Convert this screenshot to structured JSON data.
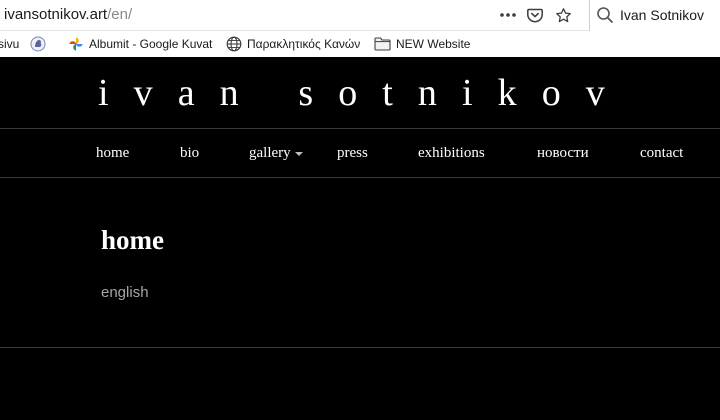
{
  "browser": {
    "url_host": "ivansotnikov.art",
    "url_path": "/en/",
    "search_value": "Ivan Sotnikov"
  },
  "bookmarks": [
    {
      "label": "sivu",
      "icon": "bookmark-icon"
    },
    {
      "label": "",
      "icon": "lion-logo-icon"
    },
    {
      "label": "Albumit - Google Kuvat",
      "icon": "google-photos-icon"
    },
    {
      "label": "Παρακλητικός Κανών",
      "icon": "globe-icon"
    },
    {
      "label": "NEW Website",
      "icon": "folder-icon"
    }
  ],
  "site": {
    "title": "ivan sotnikov",
    "nav": [
      {
        "label": "home"
      },
      {
        "label": "bio"
      },
      {
        "label": "gallery",
        "has_dropdown": true
      },
      {
        "label": "press"
      },
      {
        "label": "exhibitions"
      },
      {
        "label": "новости"
      },
      {
        "label": "contact"
      }
    ]
  },
  "main": {
    "heading": "home",
    "language": "english"
  },
  "colors": {
    "background": "#000000",
    "text": "#ffffff",
    "muted": "#a6a6a6",
    "divider": "#3a3a3a"
  }
}
